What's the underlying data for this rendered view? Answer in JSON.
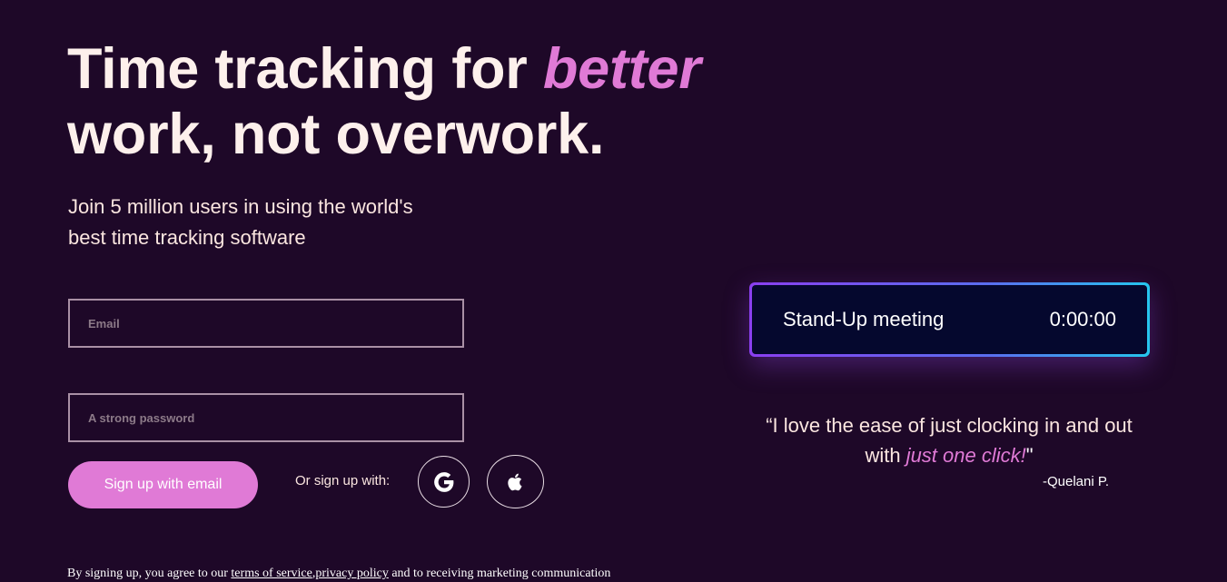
{
  "hero": {
    "headline_part1": "Time tracking for ",
    "headline_accent": "better",
    "headline_part2": "work, not overwork.",
    "subhead": "Join 5 million users in using the world's best time tracking software"
  },
  "form": {
    "email_placeholder": "Email",
    "password_placeholder": "A strong password",
    "signup_label": "Sign up with email",
    "or_label": "Or sign up with:",
    "social": [
      {
        "provider": "Google",
        "icon": "google-icon"
      },
      {
        "provider": "Apple",
        "icon": "apple-icon"
      }
    ]
  },
  "legal": {
    "prefix": "By signing up, you agree to our ",
    "terms_link": "terms of service",
    "separator": ",",
    "privacy_link": "privacy policy",
    "suffix": " and to receiving marketing communication"
  },
  "timer": {
    "task": "Stand-Up meeting",
    "time": "0:00:00"
  },
  "testimonial": {
    "quote_part1": "“I love the ease of just clocking in and out with ",
    "quote_accent": "just one click!",
    "quote_close": "\"",
    "author": "-Quelani P."
  },
  "colors": {
    "background": "#1e0828",
    "accent": "#e07ad6",
    "timer_background": "#05082e",
    "gradient_start": "#8a3ff0",
    "gradient_end": "#25c6ee"
  }
}
